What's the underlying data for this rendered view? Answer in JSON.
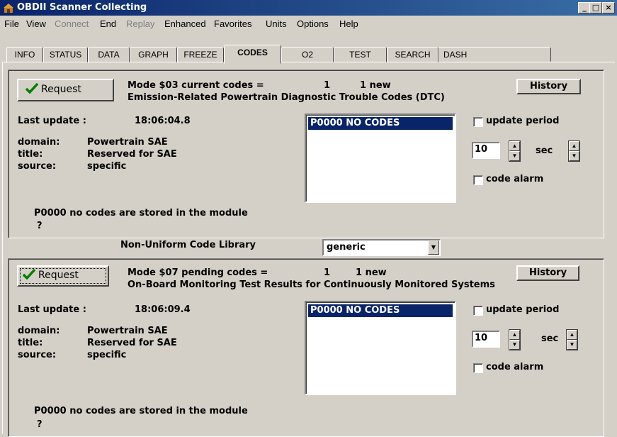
{
  "window": {
    "title": "OBDII Scanner Collecting",
    "min": "_",
    "max": "□",
    "close": "×"
  },
  "menu": [
    {
      "label": "File",
      "enabled": true
    },
    {
      "label": "View",
      "enabled": true
    },
    {
      "label": "Connect",
      "enabled": false
    },
    {
      "label": "End",
      "enabled": true
    },
    {
      "label": "Replay",
      "enabled": false
    },
    {
      "label": "Enhanced",
      "enabled": true
    },
    {
      "label": "Favorites",
      "enabled": true
    },
    {
      "label": "Units",
      "enabled": true
    },
    {
      "label": "Options",
      "enabled": true
    },
    {
      "label": "Help",
      "enabled": true
    }
  ],
  "tabs": [
    "INFO",
    "STATUS",
    "DATA",
    "GRAPH",
    "FREEZE",
    "CODES",
    "O2",
    "TEST",
    "SEARCH",
    "DASH"
  ],
  "active_tab": "CODES",
  "library": {
    "label": "Non-Uniform Code Library",
    "value": "generic"
  },
  "panels": [
    {
      "request_label": "Request",
      "mode_line": "Mode $03   current codes =",
      "count": "1",
      "new": "1 new",
      "description": "Emission-Related Powertrain Diagnostic Trouble Codes (DTC)",
      "history_label": "History",
      "last_update_label": "Last update :",
      "last_update": "18:06:04.8",
      "domain_label": "domain:",
      "domain": "Powertrain SAE",
      "title_label": "title:",
      "title": "Reserved for SAE",
      "source_label": "source:",
      "source": "specific",
      "list_item": "P0000 NO CODES",
      "update_period_label": "update period",
      "period_value": "10",
      "period_unit": "sec",
      "code_alarm_label": "code alarm",
      "message": "P0000 no codes are stored in the module",
      "message2": "?"
    },
    {
      "request_label": "Request",
      "mode_line": "Mode $07  pending codes =",
      "count": "1",
      "new": "1 new",
      "description": "On-Board Monitoring Test Results for Continuously Monitored Systems",
      "history_label": "History",
      "last_update_label": "Last update :",
      "last_update": "18:06:09.4",
      "domain_label": "domain:",
      "domain": "Powertrain SAE",
      "title_label": "title:",
      "title": "Reserved for SAE",
      "source_label": "source:",
      "source": "specific",
      "list_item": "P0000 NO CODES",
      "update_period_label": "update period",
      "period_value": "10",
      "period_unit": "sec",
      "code_alarm_label": "code alarm",
      "message": "P0000 no codes are stored in the module",
      "message2": "?"
    }
  ]
}
